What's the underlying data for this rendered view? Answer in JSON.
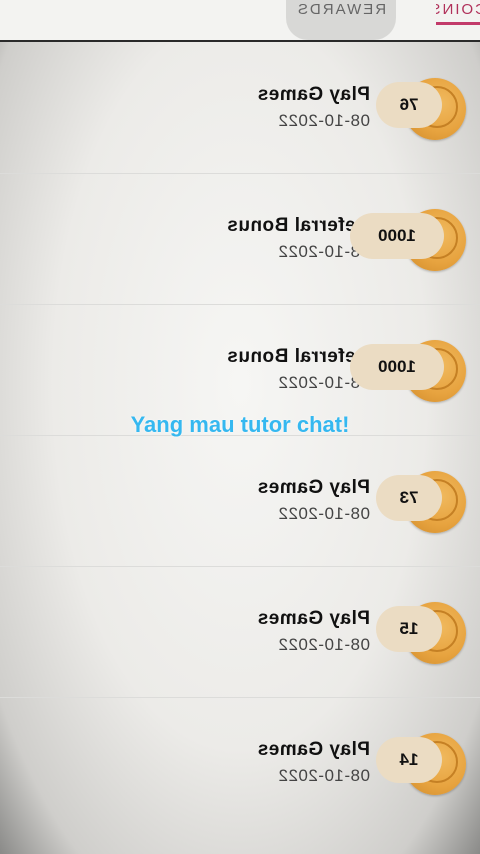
{
  "tabs": {
    "coins_label": "COINS",
    "rewards_label": "REWARDS"
  },
  "transactions": [
    {
      "title": "Play Games",
      "date": "08-10-2022",
      "amount": "76"
    },
    {
      "title": "Referral Bonus",
      "date": "08-10-2022",
      "amount": "1000"
    },
    {
      "title": "Referral Bonus",
      "date": "08-10-2022",
      "amount": "1000"
    },
    {
      "title": "Play Games",
      "date": "08-10-2022",
      "amount": "73"
    },
    {
      "title": "Play Games",
      "date": "08-10-2022",
      "amount": "15"
    },
    {
      "title": "Play Games",
      "date": "08-10-2022",
      "amount": "14"
    }
  ],
  "overlay": {
    "caption": "Yang mau tutor chat!"
  },
  "colors": {
    "coin": "#e7a33f",
    "pill": "#ebdcc3",
    "caption": "#35b8f0",
    "active_tab": "#c23a6a"
  }
}
